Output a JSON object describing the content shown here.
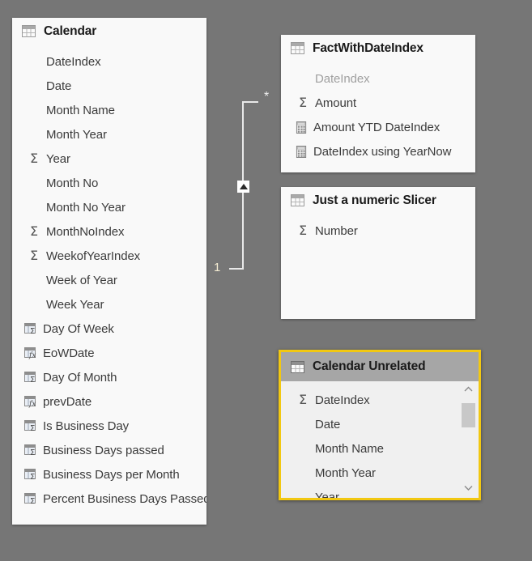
{
  "canvas": {
    "background_color": "#767676",
    "selection_color": "#f2c811"
  },
  "tables": [
    {
      "id": "calendar",
      "name": "Calendar",
      "icon": "table-icon",
      "selected": false,
      "fields": [
        {
          "name": "DateIndex",
          "icon": "none",
          "dim": false
        },
        {
          "name": "Date",
          "icon": "none",
          "dim": false
        },
        {
          "name": "Month Name",
          "icon": "none",
          "dim": false
        },
        {
          "name": "Month Year",
          "icon": "none",
          "dim": false
        },
        {
          "name": "Year",
          "icon": "sigma-icon",
          "dim": false
        },
        {
          "name": "Month No",
          "icon": "none",
          "dim": false
        },
        {
          "name": "Month No Year",
          "icon": "none",
          "dim": false
        },
        {
          "name": "MonthNoIndex",
          "icon": "sigma-icon",
          "dim": false
        },
        {
          "name": "WeekofYearIndex",
          "icon": "sigma-icon",
          "dim": false
        },
        {
          "name": "Week of Year",
          "icon": "none",
          "dim": false
        },
        {
          "name": "Week Year",
          "icon": "none",
          "dim": false
        },
        {
          "name": "Day Of Week",
          "icon": "calc-column-sigma-icon",
          "dim": false
        },
        {
          "name": "EoWDate",
          "icon": "calc-column-fx-icon",
          "dim": false
        },
        {
          "name": "Day Of Month",
          "icon": "calc-column-sigma-icon",
          "dim": false
        },
        {
          "name": "prevDate",
          "icon": "calc-column-fx-icon",
          "dim": false
        },
        {
          "name": "Is Business Day",
          "icon": "calc-column-sigma-icon",
          "dim": false
        },
        {
          "name": "Business Days passed",
          "icon": "calc-column-sigma-icon",
          "dim": false
        },
        {
          "name": "Business Days per Month",
          "icon": "calc-column-sigma-icon",
          "dim": false
        },
        {
          "name": "Percent Business Days Passed",
          "icon": "calc-column-sigma-icon",
          "dim": false
        }
      ]
    },
    {
      "id": "factwithdateindex",
      "name": "FactWithDateIndex",
      "icon": "table-icon",
      "selected": false,
      "fields": [
        {
          "name": "DateIndex",
          "icon": "none",
          "dim": true
        },
        {
          "name": "Amount",
          "icon": "sigma-icon",
          "dim": false
        },
        {
          "name": "Amount YTD DateIndex",
          "icon": "measure-icon",
          "dim": false
        },
        {
          "name": "DateIndex using YearNow",
          "icon": "measure-icon",
          "dim": false
        }
      ]
    },
    {
      "id": "just-a-numeric-slicer",
      "name": "Just a numeric Slicer",
      "icon": "table-icon",
      "selected": false,
      "fields": [
        {
          "name": "Number",
          "icon": "sigma-icon",
          "dim": false
        }
      ]
    },
    {
      "id": "calendar-unrelated",
      "name": "Calendar Unrelated",
      "icon": "table-icon",
      "selected": true,
      "fields": [
        {
          "name": "DateIndex",
          "icon": "sigma-icon",
          "dim": false
        },
        {
          "name": "Date",
          "icon": "none",
          "dim": false
        },
        {
          "name": "Month Name",
          "icon": "none",
          "dim": false
        },
        {
          "name": "Month Year",
          "icon": "none",
          "dim": false
        },
        {
          "name": "Year",
          "icon": "none",
          "dim": false
        }
      ],
      "scrollbar": {
        "up_icon": "chevron-up-icon",
        "down_icon": "chevron-down-icon"
      }
    }
  ],
  "relationship": {
    "from_table": "Calendar",
    "to_table": "FactWithDateIndex",
    "many_cardinality": "*",
    "one_cardinality": "1",
    "cross_filter_icon": "cross-filter-arrow-icon"
  }
}
